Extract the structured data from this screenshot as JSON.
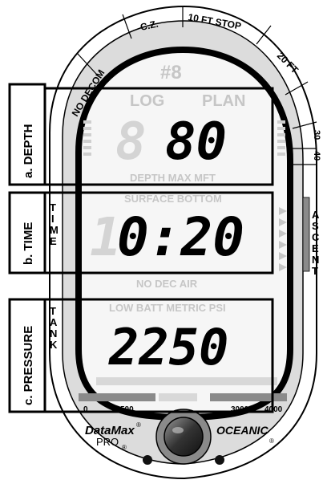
{
  "device": {
    "brand_model": "DataMax",
    "brand_sub": "PRO",
    "reg_mark": "®",
    "maker": "OCEANIC",
    "maker_reg": "®"
  },
  "bezel_zones": {
    "no_decom": "NO DECOM",
    "cz": "C.Z.",
    "ten_ft_stop": "10 FT  STOP",
    "twenty_ft": "20 FT",
    "thirty": "30",
    "forty": "40"
  },
  "callouts": {
    "depth": "a. DEPTH",
    "time": "b. TIME",
    "pressure": "c. PRESSURE"
  },
  "side_labels": {
    "time": [
      "T",
      "I",
      "M",
      "E"
    ],
    "tank": [
      "T",
      "A",
      "N",
      "K"
    ],
    "ascent": [
      "A",
      "S",
      "C",
      "E",
      "N",
      "T"
    ]
  },
  "lcd": {
    "dive_hash": "#8",
    "log": "LOG",
    "plan": "PLAN",
    "depth_value": "80",
    "depth_ghost": "8",
    "depth_units": "DEPTH MAX MFT",
    "surface_bottom": "SURFACE BOTTOM",
    "time_value": "0:20",
    "time_ghost": "1",
    "nodec_air": "NO DEC    AIR",
    "low_batt": "LOW BATT METRIC PSI",
    "pressure_value": "2250"
  },
  "tank_scale": {
    "tick_0": "0",
    "tick_500": "500",
    "tick_3000": "3000",
    "tick_4000": "4000"
  },
  "colors": {
    "ghost": "#c6c6c6",
    "bezel": "#dcdcdc",
    "dark": "#000000",
    "gray_bar": "#8a8a8a"
  }
}
